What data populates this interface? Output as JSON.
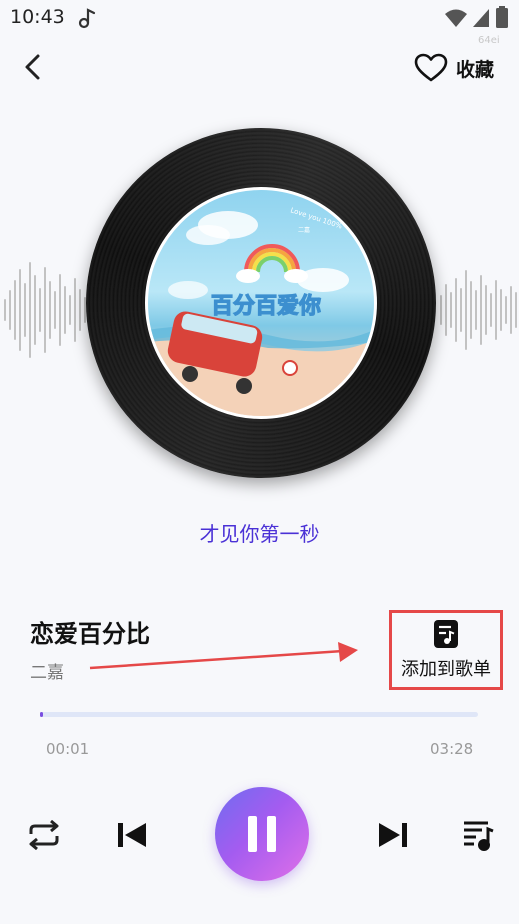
{
  "status_bar": {
    "time": "10:43",
    "icons": [
      "music-note-icon",
      "wifi-icon",
      "signal-icon",
      "battery-icon"
    ]
  },
  "watermark": "64ei",
  "header": {
    "back_icon": "chevron-left-icon",
    "favorite_icon": "heart-outline-icon",
    "favorite_label": "收藏"
  },
  "cover": {
    "art_title": "百分百爱你",
    "art_subtitle": "Love you 100%",
    "art_caption": "二嘉"
  },
  "lyric": {
    "current_line": "才见你第一秒"
  },
  "song": {
    "title": "恋爱百分比",
    "artist": "二嘉"
  },
  "add_to_playlist": {
    "icon": "playlist-note-icon",
    "label": "添加到歌单"
  },
  "progress": {
    "current": "00:01",
    "total": "03:28",
    "fraction": 0.005
  },
  "controls": {
    "repeat_icon": "repeat-icon",
    "previous_icon": "skip-previous-icon",
    "play_pause_icon": "pause-icon",
    "next_icon": "skip-next-icon",
    "playlist_icon": "queue-music-icon"
  },
  "colors": {
    "accent": "#4a31d6",
    "annotation": "#e54848",
    "play_gradient_start": "#6f6cf0",
    "play_gradient_end": "#e070e8",
    "progress_fill": "#7a4fe0"
  }
}
